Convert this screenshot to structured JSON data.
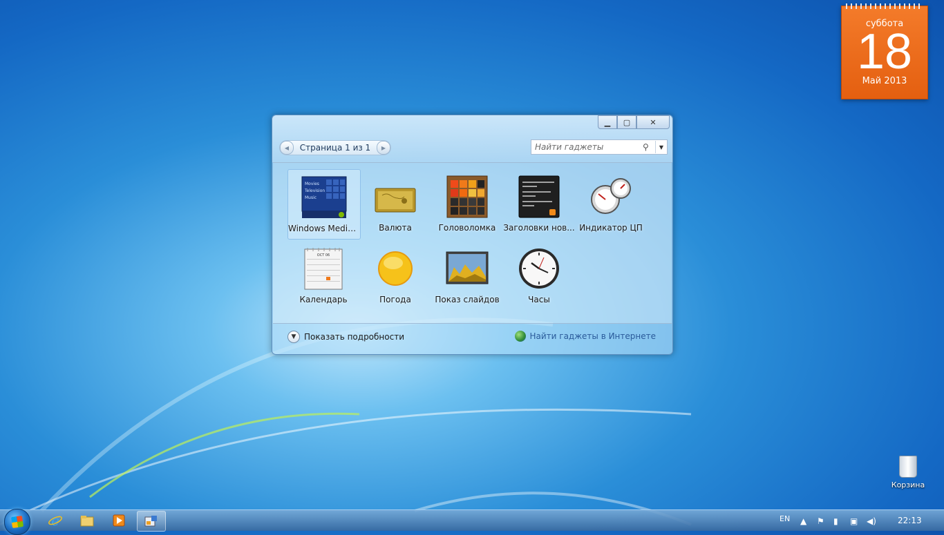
{
  "calendar_gadget": {
    "day_name": "суббота",
    "day_number": "18",
    "month_year": "Май 2013",
    "accent_color": "#e8651a"
  },
  "gallery": {
    "page_label": "Страница 1 из 1",
    "search_placeholder": "Найти гаджеты",
    "gadgets": [
      {
        "label": "Windows Media...",
        "icon": "media-center-icon",
        "selected": true
      },
      {
        "label": "Валюта",
        "icon": "currency-icon"
      },
      {
        "label": "Головоломка",
        "icon": "puzzle-icon"
      },
      {
        "label": "Заголовки нов...",
        "icon": "feed-headlines-icon"
      },
      {
        "label": "Индикатор ЦП",
        "icon": "cpu-meter-icon"
      },
      {
        "label": "Календарь",
        "icon": "calendar-icon"
      },
      {
        "label": "Погода",
        "icon": "weather-icon"
      },
      {
        "label": "Показ слайдов",
        "icon": "slideshow-icon"
      },
      {
        "label": "Часы",
        "icon": "clock-icon"
      }
    ],
    "media_menu": [
      "Movies",
      "Television",
      "Music"
    ],
    "calendar_month": "OCT 06",
    "details_label": "Показать подробности",
    "online_link": "Найти гаджеты в Интернете"
  },
  "desktop": {
    "recycle_bin_label": "Корзина"
  },
  "taskbar": {
    "language": "EN",
    "clock": "22:13"
  }
}
